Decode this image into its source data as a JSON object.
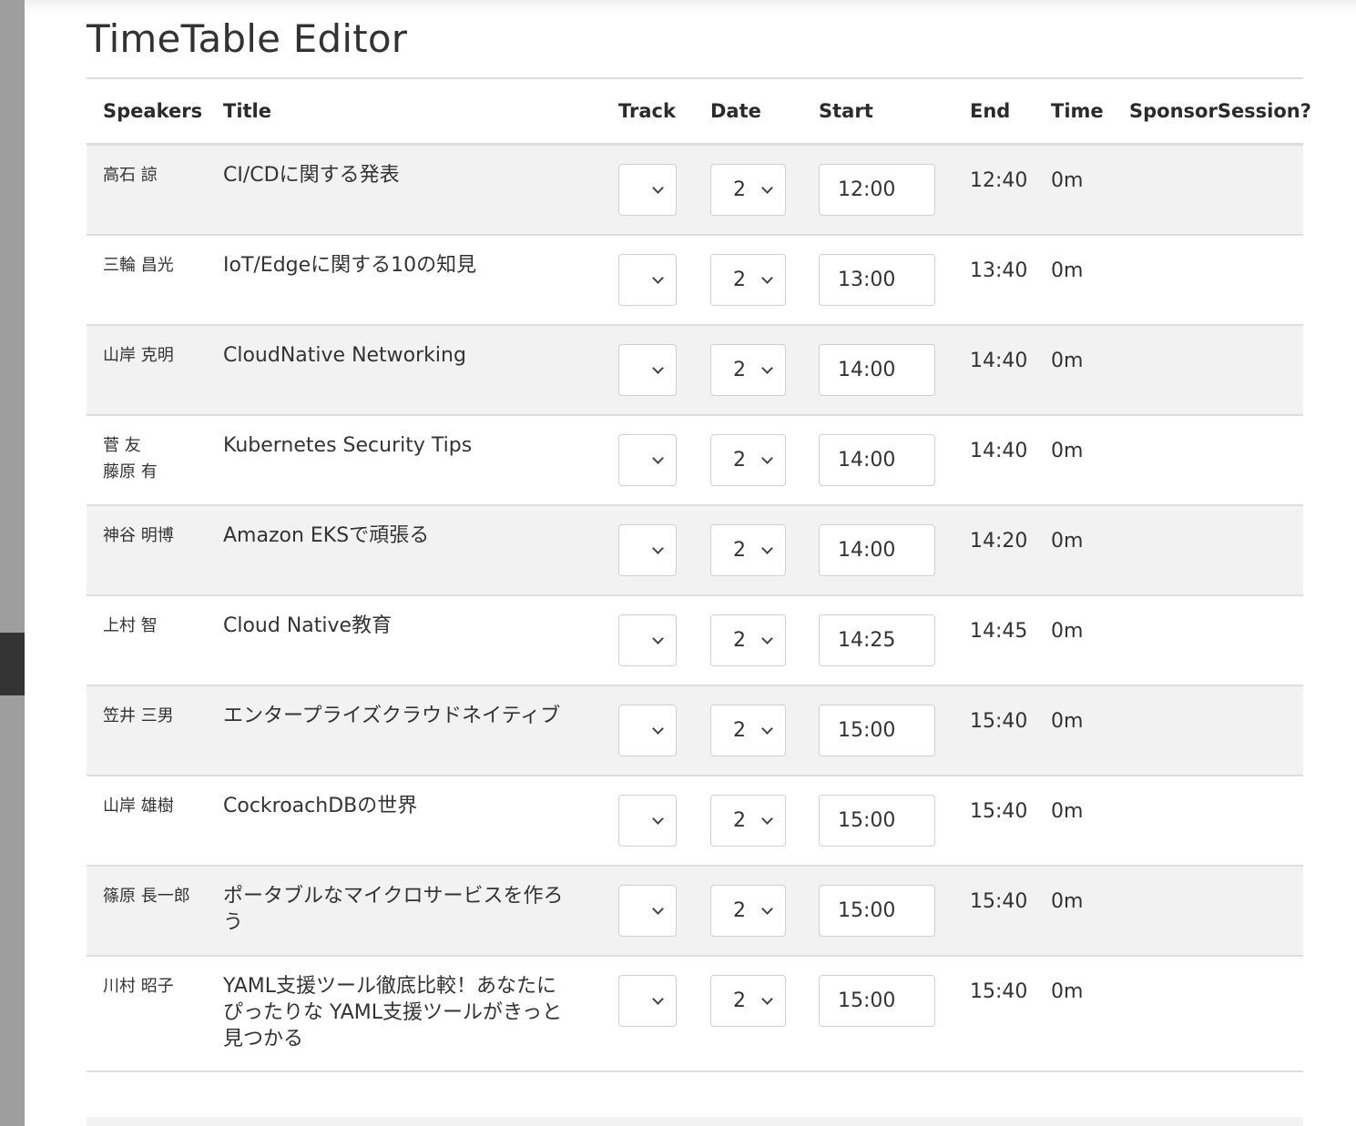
{
  "page": {
    "title": "TimeTable Editor"
  },
  "table": {
    "headers": {
      "speakers": "Speakers",
      "title": "Title",
      "track": "Track",
      "date": "Date",
      "start": "Start",
      "end": "End",
      "time": "Time",
      "sponsor": "SponsorSession?"
    },
    "rows": [
      {
        "speakers": [
          "高石 諒"
        ],
        "title": "CI/CDに関する発表",
        "track": "",
        "date": "2",
        "start": "12:00",
        "end": "12:40",
        "time": "0m",
        "sponsor": ""
      },
      {
        "speakers": [
          "三輪 昌光"
        ],
        "title": "IoT/Edgeに関する10の知見",
        "track": "",
        "date": "2",
        "start": "13:00",
        "end": "13:40",
        "time": "0m",
        "sponsor": ""
      },
      {
        "speakers": [
          "山岸 克明"
        ],
        "title": "CloudNative Networking",
        "track": "",
        "date": "2",
        "start": "14:00",
        "end": "14:40",
        "time": "0m",
        "sponsor": ""
      },
      {
        "speakers": [
          "菅 友",
          "藤原 有"
        ],
        "title": "Kubernetes Security Tips",
        "track": "",
        "date": "2",
        "start": "14:00",
        "end": "14:40",
        "time": "0m",
        "sponsor": ""
      },
      {
        "speakers": [
          "神谷 明博"
        ],
        "title": "Amazon EKSで頑張る",
        "track": "",
        "date": "2",
        "start": "14:00",
        "end": "14:20",
        "time": "0m",
        "sponsor": ""
      },
      {
        "speakers": [
          "上村 智"
        ],
        "title": "Cloud Native教育",
        "track": "",
        "date": "2",
        "start": "14:25",
        "end": "14:45",
        "time": "0m",
        "sponsor": ""
      },
      {
        "speakers": [
          "笠井 三男"
        ],
        "title": "エンタープライズクラウドネイティブ",
        "track": "",
        "date": "2",
        "start": "15:00",
        "end": "15:40",
        "time": "0m",
        "sponsor": ""
      },
      {
        "speakers": [
          "山岸 雄樹"
        ],
        "title": "CockroachDBの世界",
        "track": "",
        "date": "2",
        "start": "15:00",
        "end": "15:40",
        "time": "0m",
        "sponsor": ""
      },
      {
        "speakers": [
          "篠原 長一郎"
        ],
        "title": "ポータブルなマイクロサービスを作ろう",
        "track": "",
        "date": "2",
        "start": "15:00",
        "end": "15:40",
        "time": "0m",
        "sponsor": ""
      },
      {
        "speakers": [
          "川村 昭子"
        ],
        "title": "YAML支援ツール徹底比較！あなたにぴったりな YAML支援ツールがきっと見つかる",
        "track": "",
        "date": "2",
        "start": "15:00",
        "end": "15:40",
        "time": "0m",
        "sponsor": ""
      }
    ]
  }
}
